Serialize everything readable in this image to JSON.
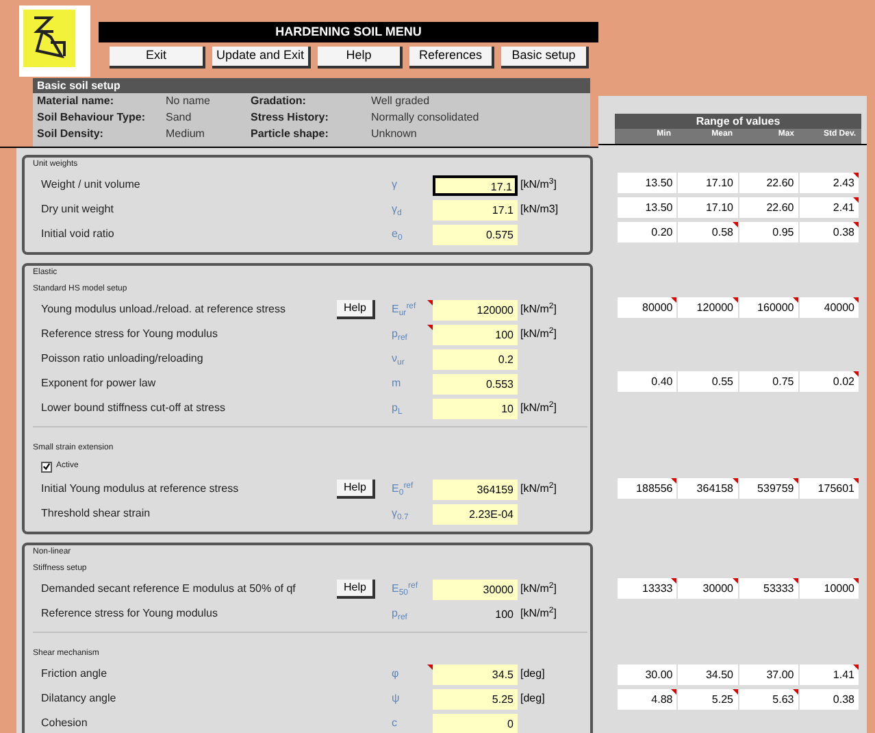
{
  "header": {
    "title": "HARDENING SOIL MENU"
  },
  "buttons": [
    "Exit",
    "Update and Exit",
    "Help",
    "References",
    "Basic setup"
  ],
  "basic_setup": {
    "title": "Basic soil setup",
    "fields": [
      {
        "label": "Material name:",
        "value": "No name"
      },
      {
        "label": "Gradation:",
        "value": "Well graded"
      },
      {
        "label": "Soil Behaviour Type:",
        "value": "Sand"
      },
      {
        "label": "Stress History:",
        "value": "Normally consolidated"
      },
      {
        "label": "Soil Density:",
        "value": "Medium"
      },
      {
        "label": "Particle shape:",
        "value": "Unknown"
      }
    ]
  },
  "range_header": {
    "title": "Range of values",
    "columns": [
      "Min",
      "Mean",
      "Max",
      "Std Dev."
    ]
  },
  "sections": [
    {
      "title": "Unit weights",
      "groups": [
        {
          "rows": [
            {
              "label": "Weight / unit volume",
              "symbol": "γ",
              "value": "17.1",
              "unit": "[kN/m$^{3}$]",
              "editable": true,
              "selected": true,
              "comment": false,
              "range": [
                {
                  "text": "13.50",
                  "comment": false
                },
                {
                  "text": "17.10",
                  "comment": false
                },
                {
                  "text": "22.60",
                  "comment": false
                },
                {
                  "text": "2.43",
                  "comment": true
                }
              ]
            },
            {
              "label": "Dry unit weight",
              "symbol": "γ$_{d}$",
              "value": "17.1",
              "unit": "[kN/m3]",
              "editable": true,
              "selected": false,
              "comment": false,
              "range": [
                {
                  "text": "13.50",
                  "comment": false
                },
                {
                  "text": "17.10",
                  "comment": false
                },
                {
                  "text": "22.60",
                  "comment": false
                },
                {
                  "text": "2.41",
                  "comment": true
                }
              ]
            },
            {
              "label": "Initial void ratio",
              "symbol": "e$_{0}$",
              "value": "0.575",
              "editable": true,
              "selected": false,
              "comment": false,
              "range": [
                {
                  "text": "0.20",
                  "comment": false
                },
                {
                  "text": "0.58",
                  "comment": true
                },
                {
                  "text": "0.95",
                  "comment": false
                },
                {
                  "text": "0.38",
                  "comment": true
                }
              ]
            }
          ]
        }
      ]
    },
    {
      "title": "Elastic",
      "groups": [
        {
          "title": "Standard HS model setup",
          "rows": [
            {
              "label": "Young modulus unload./reload. at reference stress",
              "help": "Help",
              "symbol": "E$_{ur}$$^{ref}$",
              "value": "120000",
              "unit": "[kN/m$^{2}$]",
              "editable": true,
              "selected": false,
              "comment": true,
              "range": [
                {
                  "text": "80000",
                  "comment": true
                },
                {
                  "text": "120000",
                  "comment": true
                },
                {
                  "text": "160000",
                  "comment": true
                },
                {
                  "text": "40000",
                  "comment": true
                }
              ]
            },
            {
              "label": "Reference stress for Young modulus",
              "symbol": "p$_{ref}$",
              "value": "100",
              "unit": "[kN/m$^{2}$]",
              "editable": true,
              "selected": false,
              "comment": true
            },
            {
              "label": "Poisson ratio unloading/reloading",
              "symbol": "ν$_{ur}$",
              "value": "0.2",
              "editable": true,
              "selected": false,
              "comment": false
            },
            {
              "label": "Exponent for power law",
              "symbol": "m",
              "value": "0.553",
              "editable": true,
              "selected": false,
              "comment": false,
              "range": [
                {
                  "text": "0.40",
                  "comment": false
                },
                {
                  "text": "0.55",
                  "comment": false
                },
                {
                  "text": "0.75",
                  "comment": false
                },
                {
                  "text": "0.02",
                  "comment": true
                }
              ]
            },
            {
              "label": "Lower bound stiffness cut-off at stress",
              "symbol": "p$_{L}$",
              "value": "10",
              "unit": "[kN/m$^{2}$]",
              "editable": true,
              "selected": false,
              "comment": false
            }
          ]
        },
        {
          "title": "Small strain extension",
          "checkbox": {
            "label": "Active",
            "checked": true
          },
          "rows": [
            {
              "label": "Initial Young modulus at reference stress",
              "help": "Help",
              "symbol": "E$_{0}$$^{ref}$",
              "value": "364159",
              "unit": "[kN/m$^{2}$]",
              "editable": true,
              "selected": false,
              "comment": false,
              "range": [
                {
                  "text": "188556",
                  "comment": true
                },
                {
                  "text": "364158",
                  "comment": true
                },
                {
                  "text": "539759",
                  "comment": true
                },
                {
                  "text": "175601",
                  "comment": true
                }
              ]
            },
            {
              "label": "Threshold shear strain",
              "symbol": "γ$_{0.7}$",
              "value": "2.23E-04",
              "editable": true,
              "selected": false,
              "comment": false
            }
          ]
        }
      ]
    },
    {
      "title": "Non-linear",
      "groups": [
        {
          "title": "Stiffness setup",
          "rows": [
            {
              "label": "Demanded secant reference E modulus at 50% of qf",
              "help": "Help",
              "symbol": "E$_{50}$$^{ref}$",
              "value": "30000",
              "unit": "[kN/m$^{2}$]",
              "editable": true,
              "selected": false,
              "comment": false,
              "range": [
                {
                  "text": "13333",
                  "comment": true
                },
                {
                  "text": "30000",
                  "comment": true
                },
                {
                  "text": "53333",
                  "comment": true
                },
                {
                  "text": "10000",
                  "comment": true
                }
              ]
            },
            {
              "label": "Reference stress for Young modulus",
              "symbol": "p$_{ref}$",
              "value": "100",
              "unit": "[kN/m$^{2}$]",
              "editable": false,
              "selected": false,
              "comment": false
            }
          ]
        },
        {
          "title": "Shear mechanism",
          "rows": [
            {
              "label": "Friction angle",
              "symbol": "φ",
              "value": "34.5",
              "unit": "[deg]",
              "editable": true,
              "selected": false,
              "comment": true,
              "range": [
                {
                  "text": "30.00",
                  "comment": false
                },
                {
                  "text": "34.50",
                  "comment": false
                },
                {
                  "text": "37.00",
                  "comment": false
                },
                {
                  "text": "1.41",
                  "comment": true
                }
              ]
            },
            {
              "label": "Dilatancy angle",
              "symbol": "ψ",
              "value": "5.25",
              "unit": "[deg]",
              "editable": true,
              "selected": false,
              "comment": false,
              "range": [
                {
                  "text": "4.88",
                  "comment": true
                },
                {
                  "text": "5.25",
                  "comment": true
                },
                {
                  "text": "5.63",
                  "comment": true
                },
                {
                  "text": "0.38",
                  "comment": false
                }
              ]
            },
            {
              "label": "Cohesion",
              "symbol": "c",
              "value": "0",
              "editable": true,
              "selected": false,
              "comment": false
            }
          ]
        }
      ]
    }
  ]
}
